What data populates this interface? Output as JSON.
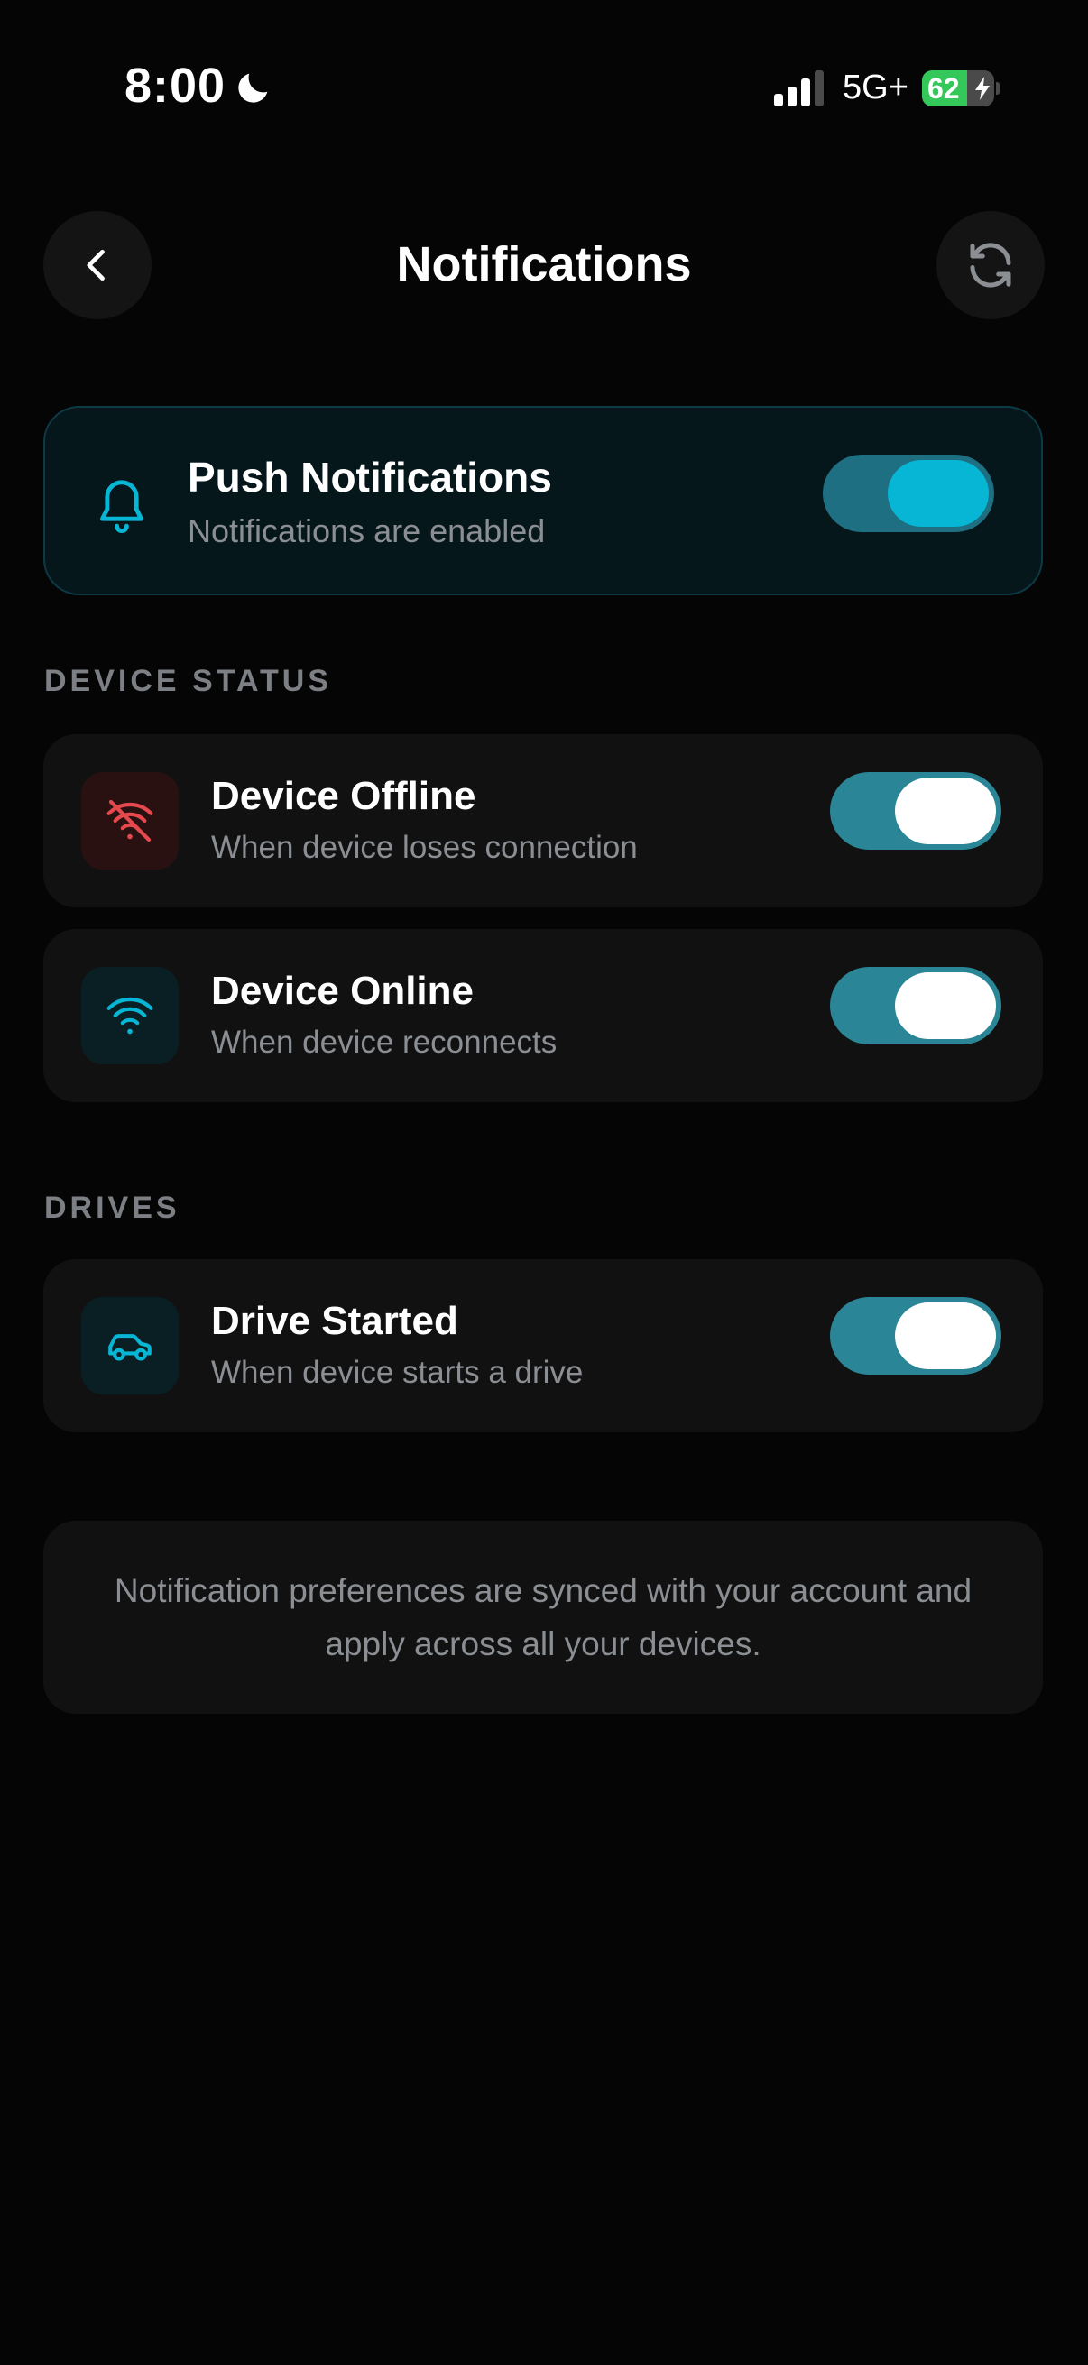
{
  "status_bar": {
    "time": "8:00",
    "network": "5G+",
    "battery_percent": "62",
    "battery_level": 0.62,
    "icons": [
      "moon-icon",
      "signal-bars-icon",
      "battery-charging-icon"
    ]
  },
  "header": {
    "title": "Notifications",
    "back_icon": "chevron-left-icon",
    "refresh_icon": "refresh-icon"
  },
  "push": {
    "title": "Push Notifications",
    "subtitle": "Notifications are enabled",
    "enabled": true,
    "icon": "bell-icon"
  },
  "sections": [
    {
      "label": "DEVICE STATUS",
      "items": [
        {
          "title": "Device Offline",
          "subtitle": "When device loses connection",
          "enabled": true,
          "icon": "wifi-off-icon"
        },
        {
          "title": "Device Online",
          "subtitle": "When device reconnects",
          "enabled": true,
          "icon": "wifi-icon"
        }
      ]
    },
    {
      "label": "DRIVES",
      "items": [
        {
          "title": "Drive Started",
          "subtitle": "When device starts a drive",
          "enabled": true,
          "icon": "car-icon"
        }
      ]
    }
  ],
  "note": "Notification preferences are synced with your account and apply across all your devices.",
  "colors": {
    "background": "#050505",
    "accent": "#06b6d4",
    "toggle_on": "#2a8597",
    "danger": "#e5484d",
    "muted_text": "#8b8f94"
  }
}
